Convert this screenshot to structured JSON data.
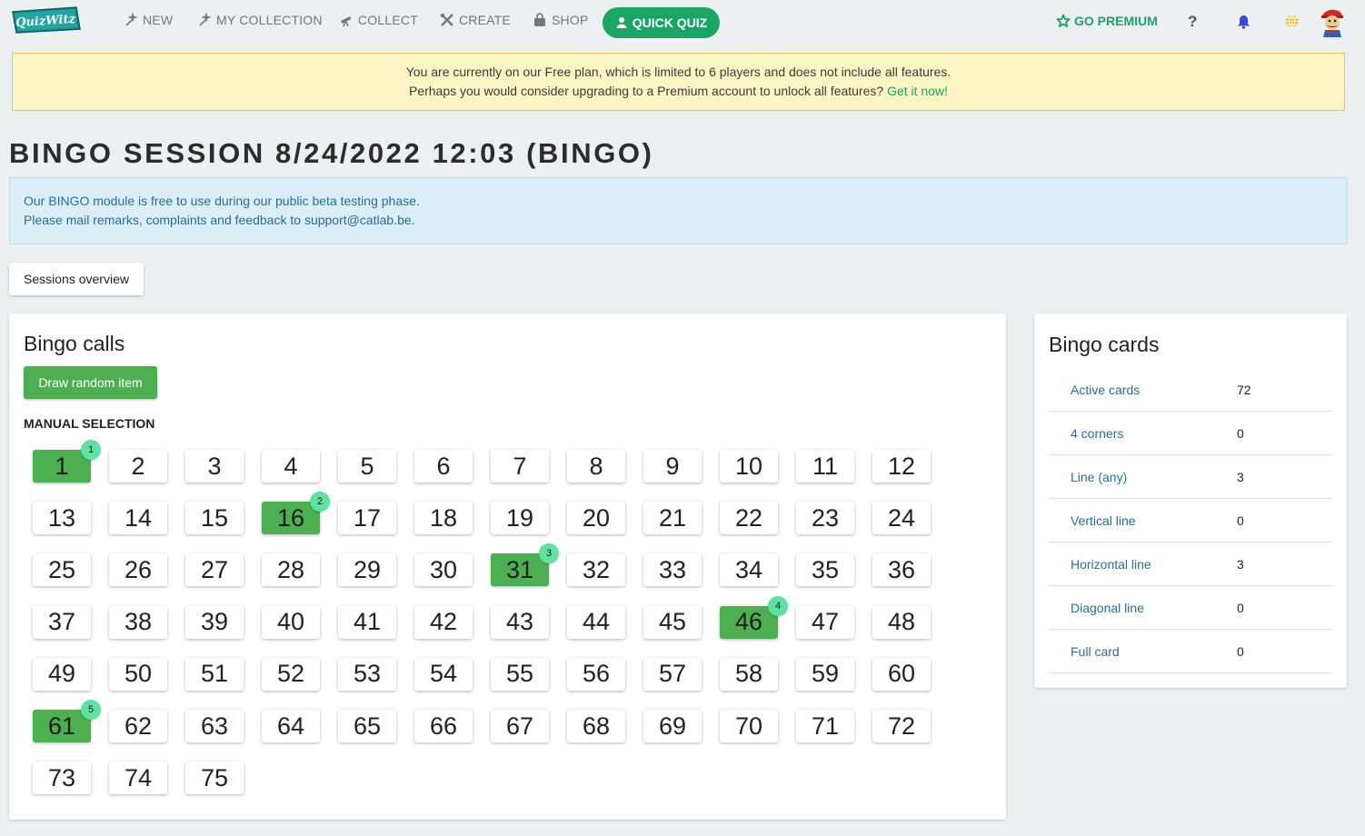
{
  "nav": {
    "logo_text": "QuizWitz",
    "items": [
      {
        "label": "NEW",
        "icon": "sparkle-icon"
      },
      {
        "label": "MY COLLECTION",
        "icon": "sparkle-icon"
      },
      {
        "label": "COLLECT",
        "icon": "telescope-icon"
      },
      {
        "label": "CREATE",
        "icon": "tools-icon"
      },
      {
        "label": "SHOP",
        "icon": "bag-icon"
      }
    ],
    "quick_quiz": "QUICK QUIZ",
    "premium": "GO PREMIUM",
    "help": "?"
  },
  "colors": {
    "accent": "#1aa567",
    "called": "#4caf50",
    "badge": "#5fe1a3",
    "link": "#2b6d93"
  },
  "warning": {
    "line1": "You are currently on our Free plan, which is limited to 6 players and does not include all features.",
    "line2": "Perhaps you would consider upgrading to a Premium account to unlock all features? ",
    "link": "Get it now!"
  },
  "page_title": "BINGO SESSION 8/24/2022 12:03 (BINGO)",
  "info": {
    "line1": "Our BINGO module is free to use during our public beta testing phase.",
    "line2": "Please mail remarks, complaints and feedback to ",
    "email": "support@catlab.be",
    "line2_end": "."
  },
  "sessions_overview": "Sessions overview",
  "calls": {
    "title": "Bingo calls",
    "draw_button": "Draw random item",
    "manual_label": "MANUAL SELECTION",
    "numbers": [
      "1",
      "2",
      "3",
      "4",
      "5",
      "6",
      "7",
      "8",
      "9",
      "10",
      "11",
      "12",
      "13",
      "14",
      "15",
      "16",
      "17",
      "18",
      "19",
      "20",
      "21",
      "22",
      "23",
      "24",
      "25",
      "26",
      "27",
      "28",
      "29",
      "30",
      "31",
      "32",
      "33",
      "34",
      "35",
      "36",
      "37",
      "38",
      "39",
      "40",
      "41",
      "42",
      "43",
      "44",
      "45",
      "46",
      "47",
      "48",
      "49",
      "50",
      "51",
      "52",
      "53",
      "54",
      "55",
      "56",
      "57",
      "58",
      "59",
      "60",
      "61",
      "62",
      "63",
      "64",
      "65",
      "66",
      "67",
      "68",
      "69",
      "70",
      "71",
      "72",
      "73",
      "74",
      "75"
    ],
    "called": [
      {
        "number": "1",
        "order": "1"
      },
      {
        "number": "16",
        "order": "2"
      },
      {
        "number": "31",
        "order": "3"
      },
      {
        "number": "46",
        "order": "4"
      },
      {
        "number": "61",
        "order": "5"
      }
    ]
  },
  "cards": {
    "title": "Bingo cards",
    "stats": [
      {
        "label": "Active cards",
        "value": "72"
      },
      {
        "label": "4 corners",
        "value": "0"
      },
      {
        "label": "Line (any)",
        "value": "3"
      },
      {
        "label": "Vertical line",
        "value": "0"
      },
      {
        "label": "Horizontal line",
        "value": "3"
      },
      {
        "label": "Diagonal line",
        "value": "0"
      },
      {
        "label": "Full card",
        "value": "0"
      }
    ]
  }
}
